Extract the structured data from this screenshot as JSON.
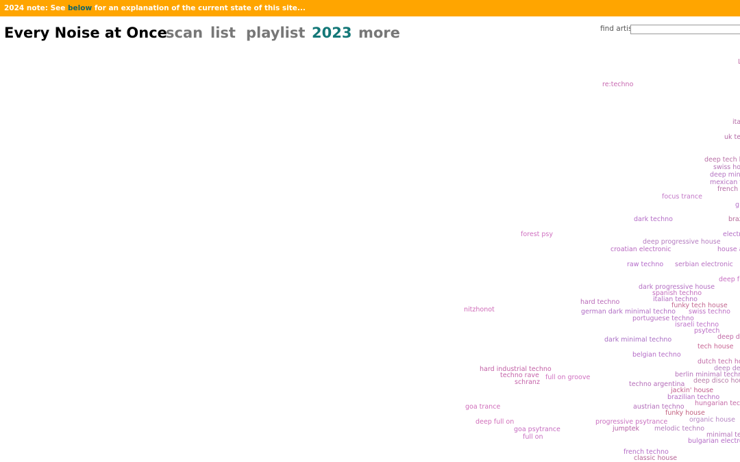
{
  "banner": {
    "prefix": "2024 note: See ",
    "link": "below",
    "suffix": " for an explanation of the current state of this site..."
  },
  "nav": {
    "title": "Every Noise at Once",
    "links": [
      "scan",
      "list",
      "playlist",
      "2023",
      "more"
    ]
  },
  "search": {
    "label": "find artist",
    "value": ""
  },
  "genres": [
    {
      "label": "re:techno",
      "color": "#c768b0"
    },
    {
      "label": "focus trance",
      "color": "#c277c7"
    },
    {
      "label": "dark techno",
      "color": "#b46cc6"
    },
    {
      "label": "forest psy",
      "color": "#cf6fc0"
    },
    {
      "label": "deep progressive house",
      "color": "#b47bbf"
    },
    {
      "label": "croatian electronic",
      "color": "#b868c0"
    },
    {
      "label": "raw techno",
      "color": "#b46bc9"
    },
    {
      "label": "serbian electronic",
      "color": "#b872c3"
    },
    {
      "label": "dark progressive house",
      "color": "#b46fc3"
    },
    {
      "label": "spanish techno",
      "color": "#c26bbd"
    },
    {
      "label": "hard techno",
      "color": "#b868b8"
    },
    {
      "label": "italian techno",
      "color": "#b46cc2"
    },
    {
      "label": "funky tech house",
      "color": "#c2668f"
    },
    {
      "label": "nitzhonot",
      "color": "#cf6bb8"
    },
    {
      "label": "german dark minimal techno",
      "color": "#b06cc4"
    },
    {
      "label": "swiss techno",
      "color": "#bd6fc5"
    },
    {
      "label": "portuguese techno",
      "color": "#b76ec2"
    },
    {
      "label": "israeli techno",
      "color": "#bd70c9"
    },
    {
      "label": "psytech",
      "color": "#bb6cc5"
    },
    {
      "label": "dark minimal techno",
      "color": "#a96ec4"
    },
    {
      "label": "tech house",
      "color": "#c76493"
    },
    {
      "label": "belgian techno",
      "color": "#b46bc6"
    },
    {
      "label": "hard industrial techno",
      "color": "#c25fa5"
    },
    {
      "label": "techno rave",
      "color": "#c462a9"
    },
    {
      "label": "full on groove",
      "color": "#cf6fc0"
    },
    {
      "label": "schranz",
      "color": "#c462a9"
    },
    {
      "label": "berlin minimal techno",
      "color": "#b470b9"
    },
    {
      "label": "techno argentina",
      "color": "#b46bb8"
    },
    {
      "label": "jackin' house",
      "color": "#c25a8c"
    },
    {
      "label": "brazilian techno",
      "color": "#b46bc2"
    },
    {
      "label": "goa trance",
      "color": "#d06dbb"
    },
    {
      "label": "austrian techno",
      "color": "#b26bb9"
    },
    {
      "label": "funky house",
      "color": "#c2607f"
    },
    {
      "label": "organic house",
      "color": "#b584c2"
    },
    {
      "label": "deep full on",
      "color": "#d06db9"
    },
    {
      "label": "progressive psytrance",
      "color": "#c96fc0"
    },
    {
      "label": "goa psytrance",
      "color": "#c66bc0"
    },
    {
      "label": "jumptek",
      "color": "#b75fa5"
    },
    {
      "label": "melodic techno",
      "color": "#b47bbd"
    },
    {
      "label": "full on",
      "color": "#c66bc0"
    },
    {
      "label": "french techno",
      "color": "#b46bc6"
    },
    {
      "label": "classic house",
      "color": "#b76496"
    },
    {
      "label": "deep tech house",
      "color": "#b86fa6"
    },
    {
      "label": "swiss house",
      "color": "#b474b6"
    },
    {
      "label": "deep minimal techno",
      "color": "#b474c2"
    },
    {
      "label": "mexican techno",
      "color": "#b472c0"
    },
    {
      "label": "french tech house",
      "color": "#b46aa6"
    },
    {
      "label": "uk tech house",
      "color": "#b46aa6"
    },
    {
      "label": "italian tech house",
      "color": "#b46aa6"
    },
    {
      "label": "brazilian tech house",
      "color": "#b56999"
    },
    {
      "label": "electro house",
      "color": "#b46fc6"
    },
    {
      "label": "house argentina",
      "color": "#b76ec2"
    },
    {
      "label": "deep full on",
      "color": "#c76ec2"
    },
    {
      "label": "deep deep tech house",
      "color": "#c06aa6"
    },
    {
      "label": "dutch tech house",
      "color": "#c06aa6"
    },
    {
      "label": "deep deep house",
      "color": "#b57fbf"
    },
    {
      "label": "deep disco house",
      "color": "#b67aa6"
    },
    {
      "label": "hungarian techno",
      "color": "#c56aa6"
    },
    {
      "label": "minimal tech house",
      "color": "#b470b9"
    },
    {
      "label": "bulgarian electronic",
      "color": "#b46bc6"
    },
    {
      "label": "g",
      "color": "#b46fc6"
    },
    {
      "label": "L",
      "color": "#c06aa6"
    }
  ]
}
